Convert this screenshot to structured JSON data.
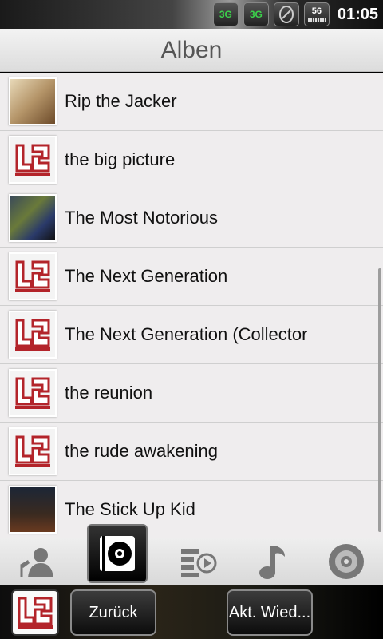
{
  "statusbar": {
    "icons": [
      "3g-icon",
      "3g-signal-icon",
      "sync-icon",
      "battery-icon"
    ],
    "network1": "3G",
    "network2": "3G",
    "battery": "56",
    "time": "01:05"
  },
  "header": {
    "title": "Alben"
  },
  "albums": [
    {
      "title": "Rip the Jacker",
      "cover": "cover1"
    },
    {
      "title": "the big picture",
      "cover": "logo"
    },
    {
      "title": "The Most Notorious",
      "cover": "cover2"
    },
    {
      "title": "The Next Generation",
      "cover": "logo"
    },
    {
      "title": "The Next Generation (Collector",
      "cover": "logo"
    },
    {
      "title": "the reunion",
      "cover": "logo"
    },
    {
      "title": "the rude awakening",
      "cover": "logo"
    },
    {
      "title": "The Stick Up Kid",
      "cover": "cover3"
    }
  ],
  "tabs": [
    "artists-icon",
    "albums-icon",
    "playlists-icon",
    "songs-icon",
    "genres-icon"
  ],
  "bottombar": {
    "back_label": "Zurück",
    "now_playing_label": "Akt. Wied..."
  },
  "colors": {
    "accent_red": "#b3242a",
    "list_bg": "#efedee"
  }
}
